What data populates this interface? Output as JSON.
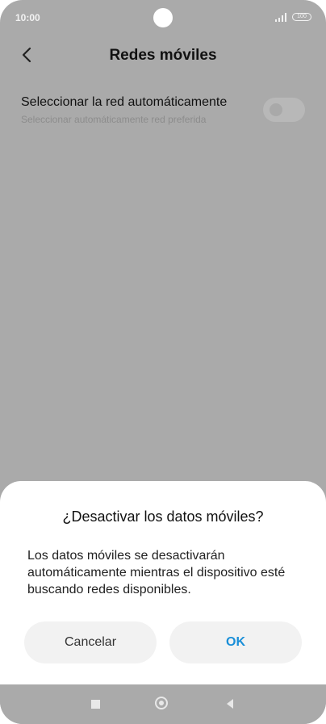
{
  "status_bar": {
    "time": "10:00",
    "battery": "100"
  },
  "header": {
    "title": "Redes móviles"
  },
  "setting": {
    "title": "Seleccionar la red automáticamente",
    "subtitle": "Seleccionar automáticamente red preferida",
    "toggle_on": false
  },
  "dialog": {
    "title": "¿Desactivar los datos móviles?",
    "body": "Los datos móviles se desactivarán automáticamente mientras el dispositivo esté buscando redes disponibles.",
    "cancel_label": "Cancelar",
    "ok_label": "OK"
  },
  "colors": {
    "accent": "#1a8fd8",
    "scrim": "#aaaaaa"
  }
}
